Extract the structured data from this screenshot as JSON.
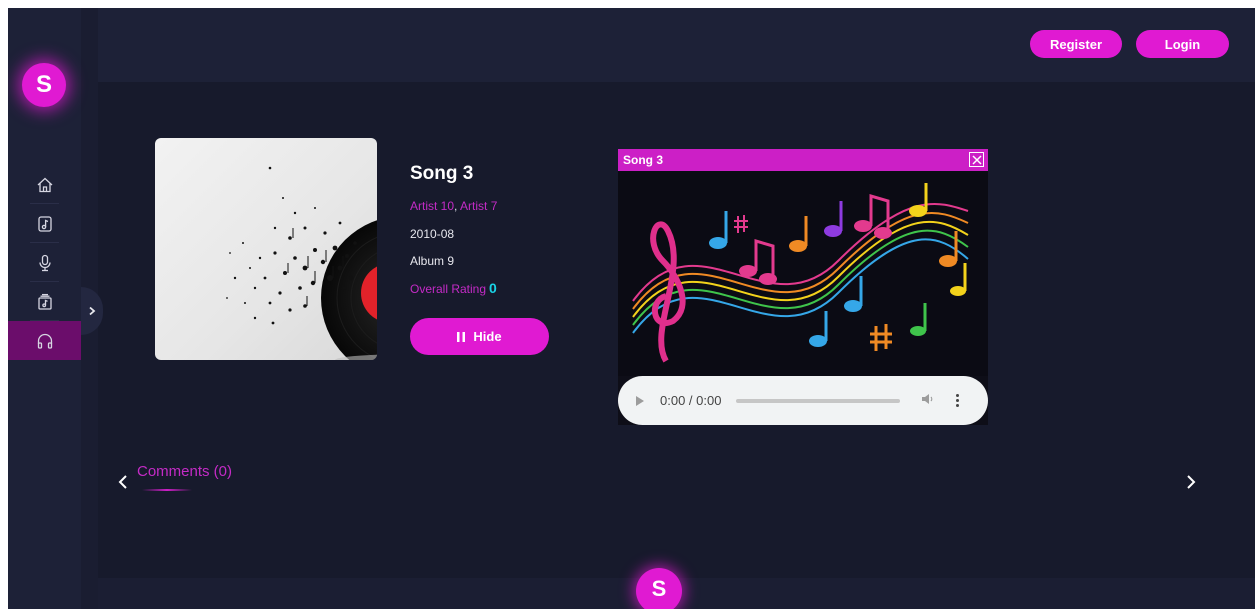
{
  "brand": {
    "logo_letter": "S",
    "accent_color": "#e01ad2",
    "background_color": "#171a2c"
  },
  "sidebar": {
    "items": [
      {
        "name": "home",
        "icon": "home-icon"
      },
      {
        "name": "songs",
        "icon": "music-file-icon"
      },
      {
        "name": "artists",
        "icon": "microphone-icon"
      },
      {
        "name": "albums",
        "icon": "album-icon"
      },
      {
        "name": "listen",
        "icon": "headphones-icon",
        "active": true
      }
    ],
    "expand_icon": "chevron-right-icon"
  },
  "header": {
    "register_label": "Register",
    "login_label": "Login"
  },
  "song": {
    "title": "Song 3",
    "artists": [
      "Artist 10",
      "Artist 7"
    ],
    "artist_separator": ",",
    "date": "2010-08",
    "album": "Album 9",
    "rating_label": "Overall Rating",
    "rating_value": "0",
    "hide_label": "Hide",
    "hide_icon": "pause-icon"
  },
  "player": {
    "title": "Song 3",
    "close_icon": "close-icon",
    "time": "0:00 / 0:00",
    "play_icon": "play-icon",
    "volume_icon": "volume-icon",
    "menu_icon": "kebab-menu-icon"
  },
  "comments": {
    "label": "Comments (0)",
    "prev_icon": "chevron-left-icon",
    "next_icon": "chevron-right-icon"
  },
  "footer": {
    "logo_letter": "S"
  }
}
